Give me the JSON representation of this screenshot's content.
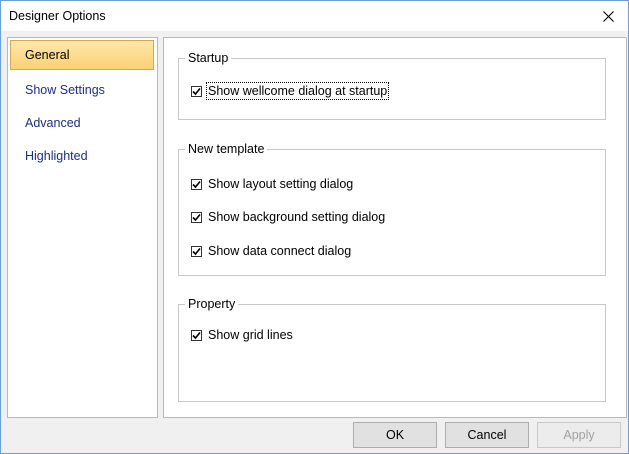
{
  "window": {
    "title": "Designer Options"
  },
  "nav": {
    "items": [
      {
        "label": "General",
        "selected": true
      },
      {
        "label": "Show Settings",
        "selected": false
      },
      {
        "label": "Advanced",
        "selected": false
      },
      {
        "label": "Highlighted",
        "selected": false
      }
    ]
  },
  "groups": {
    "startup": {
      "title": "Startup",
      "options": [
        {
          "label": "Show wellcome dialog at startup",
          "checked": true
        }
      ]
    },
    "new_template": {
      "title": "New template",
      "options": [
        {
          "label": "Show layout setting dialog",
          "checked": true
        },
        {
          "label": "Show background setting dialog",
          "checked": true
        },
        {
          "label": "Show data connect dialog",
          "checked": true
        }
      ]
    },
    "property": {
      "title": "Property",
      "options": [
        {
          "label": "Show grid lines",
          "checked": true
        }
      ]
    }
  },
  "buttons": {
    "ok": "OK",
    "cancel": "Cancel",
    "apply": "Apply"
  },
  "colors": {
    "selected_bg": "#fbd174",
    "nav_text": "#1d2f86",
    "window_border": "#6d9fd6"
  }
}
